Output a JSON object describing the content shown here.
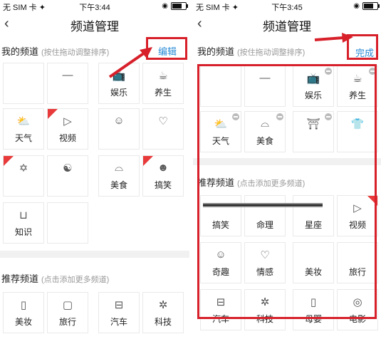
{
  "left": {
    "status": {
      "carrier": "无 SIM 卡 ✦",
      "time": "下午3:44"
    },
    "nav": {
      "back": "‹",
      "title": "频道管理"
    },
    "my": {
      "title": "我的频道",
      "hint": "(按住拖动调整排序)",
      "action": "编辑"
    },
    "rec": {
      "title": "推荐频道",
      "hint": "(点击添加更多频道)"
    },
    "labels": {
      "yule": "娱乐",
      "yangsheng": "养生",
      "tianqi": "天气",
      "shipin": "视频",
      "meishi": "美食",
      "gaoxiao": "搞笑",
      "zhishi": "知识",
      "meizhuang": "美妆",
      "lvxing": "旅行",
      "qiche": "汽车",
      "keji": "科技"
    }
  },
  "right": {
    "status": {
      "carrier": "无 SIM 卡 ✦",
      "time": "下午3:45"
    },
    "nav": {
      "back": "‹",
      "title": "频道管理"
    },
    "my": {
      "title": "我的频道",
      "hint": "(按住拖动调整排序)",
      "action": "完成"
    },
    "rec": {
      "title": "推荐频道",
      "hint": "(点击添加更多频道)"
    },
    "labels": {
      "yule": "娱乐",
      "yangsheng": "养生",
      "tianqi": "天气",
      "meishi": "美食",
      "gaoxiao": "搞笑",
      "mingli": "命理",
      "xingzuo": "星座",
      "shipin": "视频",
      "qiqu": "奇趣",
      "qinggan": "情感",
      "meizhuang": "美妆",
      "lvxing": "旅行",
      "qiche": "汽车",
      "keji": "科技",
      "muying": "母婴",
      "dianying": "电影"
    }
  },
  "colors": {
    "accent": "#2a8bd6",
    "highlight": "#d7202a"
  }
}
